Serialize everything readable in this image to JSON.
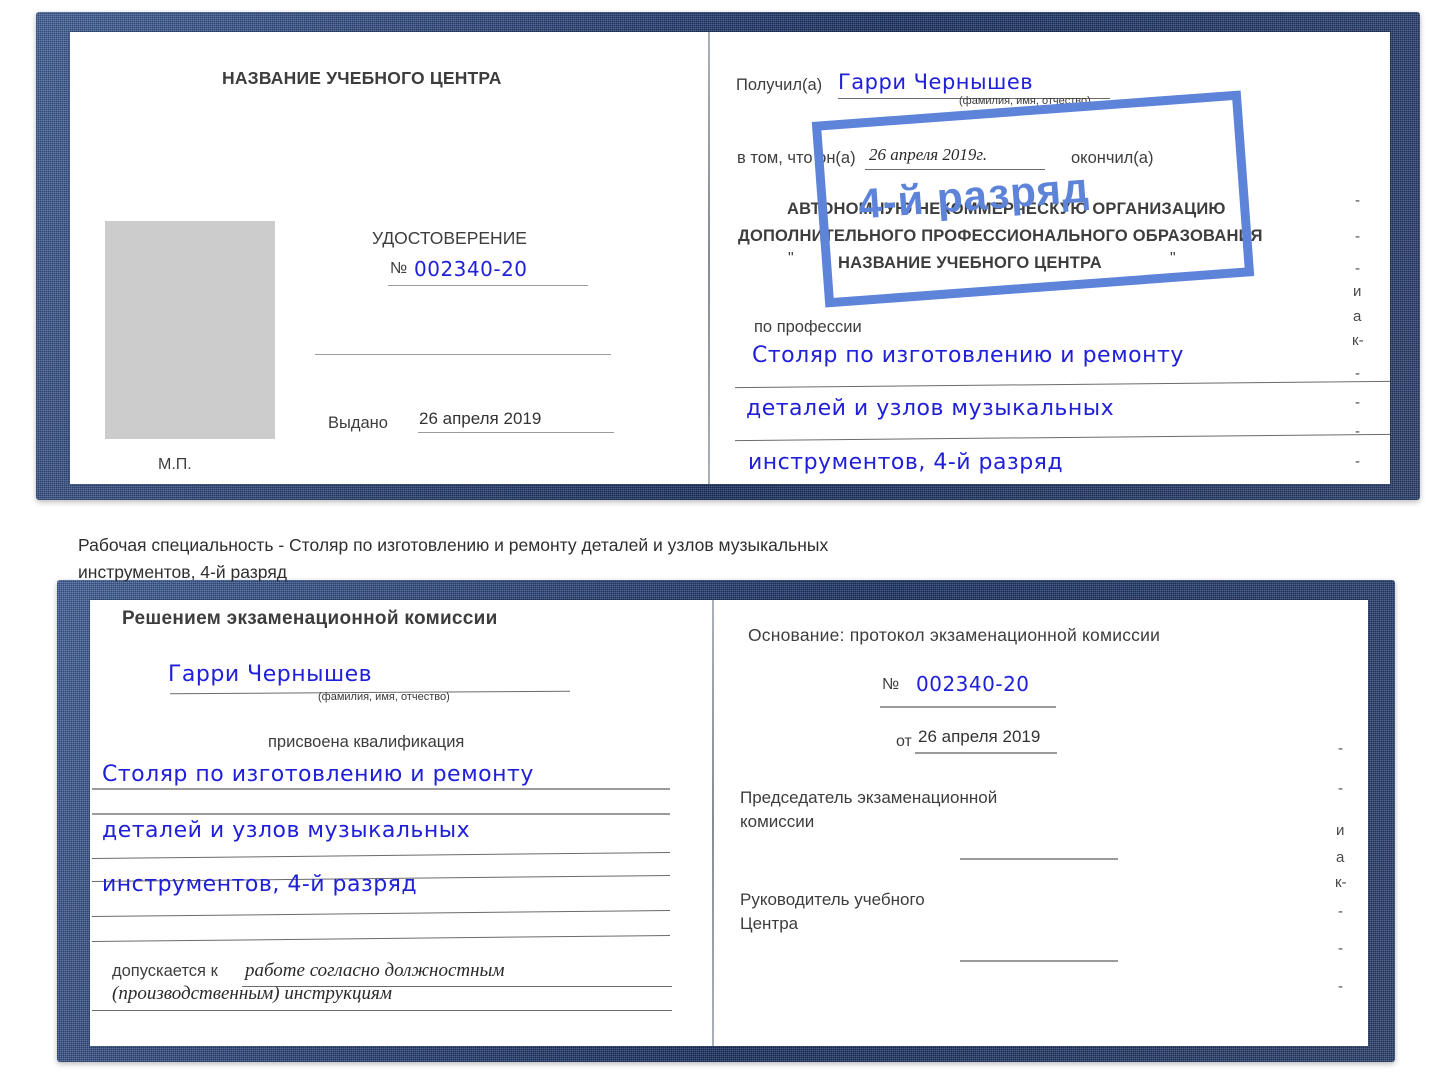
{
  "caption": {
    "line1": "Рабочая специальность - Столяр по изготовлению и ремонту деталей и узлов музыкальных",
    "line2": "инструментов, 4-й разряд"
  },
  "certificate_top": {
    "left_page": {
      "heading": "НАЗВАНИЕ УЧЕБНОГО ЦЕНТРА",
      "doc_type": "УДОСТОВЕРЕНИЕ",
      "number_label": "№",
      "number_value": "002340-20",
      "issued_label": "Выдано",
      "issued_value": "26 апреля 2019",
      "seal_label": "М.П.",
      "photo_alt": "photo-placeholder"
    },
    "right_page": {
      "received_label": "Получил(а)",
      "received_value": "Гарри Чернышев",
      "fio_hint": "(фамилия, имя, отчество)",
      "that_he_label": "в том, что он(а)",
      "completion_date": "26 апреля 2019г.",
      "finished_label": "окончил(а)",
      "org_line1": "АВТОНОМНУЮ НЕКОММЕРЧЕСКУЮ ОРГАНИЗАЦИЮ",
      "org_line2": "ДОПОЛНИТЕЛЬНОГО ПРОФЕССИОНАЛЬНОГО ОБРАЗОВАНИЯ",
      "org_quote_open": "\"",
      "org_line3": "НАЗВАНИЕ УЧЕБНОГО ЦЕНТРА",
      "org_quote_close": "\"",
      "profession_label": "по профессии",
      "profession_line1": "Столяр по изготовлению и ремонту",
      "profession_line2": "деталей и узлов музыкальных",
      "profession_line3": "инструментов, 4-й разряд",
      "stamp_text": "4-й разряд"
    },
    "edge_fragments": [
      "-",
      "-",
      "-",
      "и",
      "а",
      "к-",
      "-",
      "-",
      "-",
      "-"
    ]
  },
  "certificate_bottom": {
    "left_page": {
      "heading": "Решением экзаменационной комиссии",
      "name_value": "Гарри Чернышев",
      "fio_hint": "(фамилия, имя, отчество)",
      "qualification_label": "присвоена квалификация",
      "qualification_line1": "Столяр по изготовлению и ремонту",
      "qualification_line2": "деталей и узлов музыкальных",
      "qualification_line3": "инструментов, 4-й разряд",
      "admitted_label": "допускается к",
      "admitted_value_line1": "работе согласно должностным",
      "admitted_value_line2": "(производственным) инструкциям"
    },
    "right_page": {
      "basis_label": "Основание: протокол экзаменационной комиссии",
      "number_label": "№",
      "number_value": "002340-20",
      "date_label": "от",
      "date_value": "26 апреля 2019",
      "chairman_line1": "Председатель экзаменационной",
      "chairman_line2": "комиссии",
      "head_line1": "Руководитель учебного",
      "head_line2": "Центра"
    },
    "edge_fragments": [
      "-",
      "-",
      "и",
      "а",
      "к-",
      "-",
      "-",
      "-"
    ]
  },
  "colors": {
    "binder_blue": "#23407c",
    "ink_blue": "#2020d8",
    "stamp_blue": "#5e84da",
    "photo_gray": "#cccccc",
    "rule_gray": "#9b9b9b"
  }
}
